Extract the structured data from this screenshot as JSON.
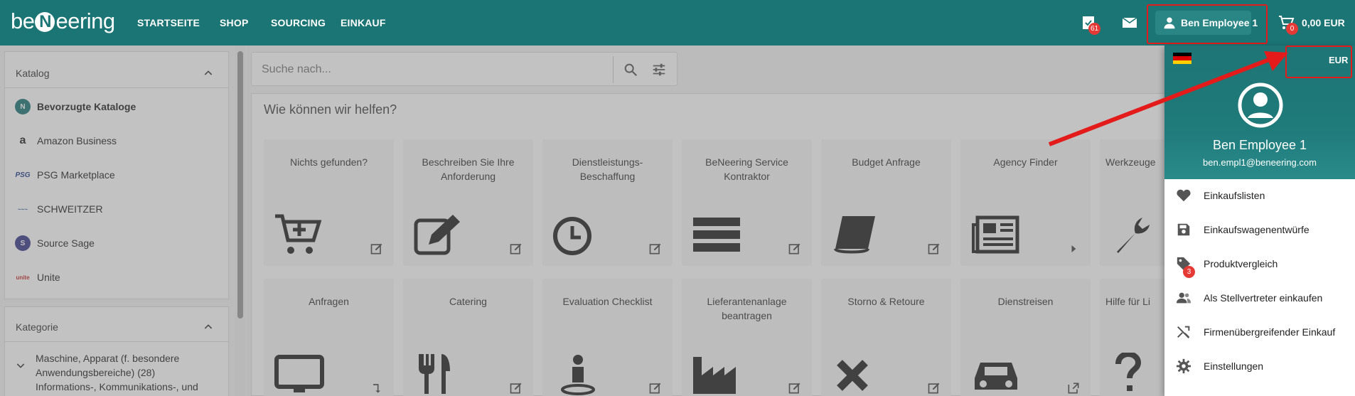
{
  "logo": {
    "pre": "be",
    "n": "N",
    "post": "eering"
  },
  "nav": [
    "STARTSEITE",
    "SHOP",
    "SOURCING",
    "EINKAUF"
  ],
  "header": {
    "approvals_badge": "61",
    "cart_badge": "0",
    "user_label": "Ben Employee 1",
    "cart_total": "0,00 EUR"
  },
  "search": {
    "placeholder": "Suche nach..."
  },
  "sidebar": {
    "catalog_title": "Katalog",
    "catalogs": [
      "Bevorzugte Kataloge",
      "Amazon Business",
      "PSG Marketplace",
      "SCHWEITZER",
      "Source Sage",
      "Unite"
    ],
    "category_title": "Kategorie",
    "category_item": "Maschine, Apparat (f. besondere Anwendungsbereiche) (28)",
    "category_item2": "Informations-, Kommunikations-, und"
  },
  "help": {
    "title": "Wie können wir helfen?",
    "row1": [
      "Nichts gefunden?",
      "Beschreiben Sie Ihre Anforderung",
      "Dienstleistungs-Beschaffung",
      "BeNeering Service Kontraktor",
      "Budget Anfrage",
      "Agency Finder",
      "Werkzeuge"
    ],
    "row2": [
      "Anfragen",
      "Catering",
      "Evaluation Checklist",
      "Lieferantenanlage beantragen",
      "Storno & Retoure",
      "Dienstreisen",
      "Hilfe für Li"
    ]
  },
  "menu": {
    "currency": "EUR",
    "name": "Ben Employee 1",
    "email": "ben.empl1@beneering.com",
    "items": [
      {
        "label": "Einkaufslisten",
        "icon": "heart-icon"
      },
      {
        "label": "Einkaufswagenentwürfe",
        "icon": "save-icon"
      },
      {
        "label": "Produktvergleich",
        "icon": "tag-icon",
        "badge": "3"
      },
      {
        "label": "Als Stellvertreter einkaufen",
        "icon": "people-icon"
      },
      {
        "label": "Firmenübergreifender Einkauf",
        "icon": "shuffle-icon"
      },
      {
        "label": "Einstellungen",
        "icon": "gear-icon"
      }
    ]
  },
  "colors": {
    "brand": "#1c7575",
    "highlight": "#e41b1b",
    "badge": "#e53935"
  }
}
